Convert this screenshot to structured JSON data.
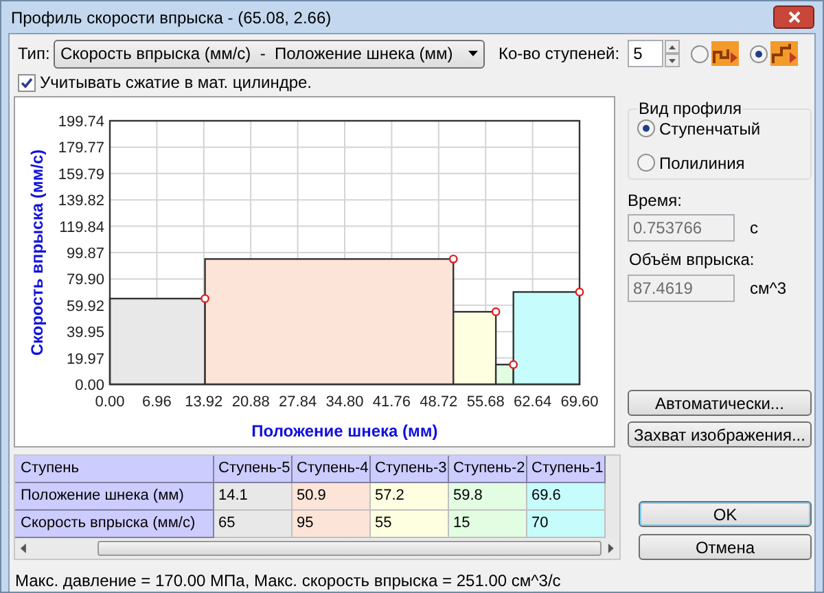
{
  "window": {
    "title": "Профиль скорости впрыска - (65.08, 2.66)"
  },
  "type_label": "Тип:",
  "type_select": {
    "value": "Скорость впрыска (мм/с)  -  Положение шнека (мм)"
  },
  "steps_label": "Ко-во ступеней:",
  "steps_field": {
    "value": "5"
  },
  "mode_radios": [
    {
      "selected": false
    },
    {
      "selected": true
    }
  ],
  "compression_checkbox": {
    "label": "Учитывать сжатие в мат. цилиндре.",
    "checked": true
  },
  "chart": {
    "chart_data": {
      "type": "bar",
      "xlabel": "Положение шнека (мм)",
      "ylabel": "Скорость впрыска (мм/с)",
      "grid": true,
      "x": [
        7.05,
        32.5,
        54.05,
        58.5,
        64.7
      ],
      "values": [
        65,
        95,
        55,
        15,
        70
      ],
      "xlim": [
        0,
        69.6
      ],
      "ylim": [
        0,
        199.74
      ],
      "xticks": [
        {
          "value": 0,
          "label": "0.00"
        },
        {
          "value": 6.96,
          "label": "6.96"
        },
        {
          "value": 13.92,
          "label": "13.92"
        },
        {
          "value": 20.88,
          "label": "20.88"
        },
        {
          "value": 27.84,
          "label": "27.84"
        },
        {
          "value": 34.8,
          "label": "34.80"
        },
        {
          "value": 41.76,
          "label": "41.76"
        },
        {
          "value": 48.72,
          "label": "48.72"
        },
        {
          "value": 55.68,
          "label": "55.68"
        },
        {
          "value": 62.64,
          "label": "62.64"
        },
        {
          "value": 69.6,
          "label": "69.60"
        }
      ],
      "yticks": [
        {
          "value": 0,
          "label": "0.00"
        },
        {
          "value": 19.97,
          "label": "19.97"
        },
        {
          "value": 39.95,
          "label": "39.95"
        },
        {
          "value": 59.92,
          "label": "59.92"
        },
        {
          "value": 79.9,
          "label": "79.90"
        },
        {
          "value": 99.87,
          "label": "99.87"
        },
        {
          "value": 119.84,
          "label": "119.84"
        },
        {
          "value": 139.82,
          "label": "139.82"
        },
        {
          "value": 159.79,
          "label": "159.79"
        },
        {
          "value": 179.77,
          "label": "179.77"
        },
        {
          "value": 199.74,
          "label": "199.74"
        }
      ]
    }
  },
  "profile_group": {
    "title": "Вид профиля",
    "options": [
      {
        "label": "Ступенчатый",
        "selected": true
      },
      {
        "label": "Полилиния",
        "selected": false
      }
    ]
  },
  "time": {
    "label": "Время:",
    "value": "0.753766",
    "unit": "с"
  },
  "volume": {
    "label": "Объём впрыска:",
    "value": "87.4619",
    "unit": "см^3"
  },
  "side_buttons": [
    "Автоматически...",
    "Захват изображения..."
  ],
  "table": {
    "header": "Ступень",
    "columns": [
      {
        "label": "Ступень-5",
        "color": "#e8e8e8"
      },
      {
        "label": "Ступень-4",
        "color": "#fde4d8"
      },
      {
        "label": "Ступень-3",
        "color": "#fefee0"
      },
      {
        "label": "Ступень-2",
        "color": "#e2fde2"
      },
      {
        "label": "Ступень-1",
        "color": "#c6fcfc"
      }
    ],
    "rows": [
      {
        "label": "Положение шнека (мм)",
        "cells": [
          "14.1",
          "50.9",
          "57.2",
          "59.8",
          "69.6"
        ]
      },
      {
        "label": "Скорость впрыска (мм/с)",
        "cells": [
          "65",
          "95",
          "55",
          "15",
          "70"
        ]
      }
    ]
  },
  "dialog_buttons": [
    "OK",
    "Отмена"
  ],
  "status": "Макс. давление = 170.00 МПа, Макс. скорость впрыска = 251.00 см^3/с"
}
